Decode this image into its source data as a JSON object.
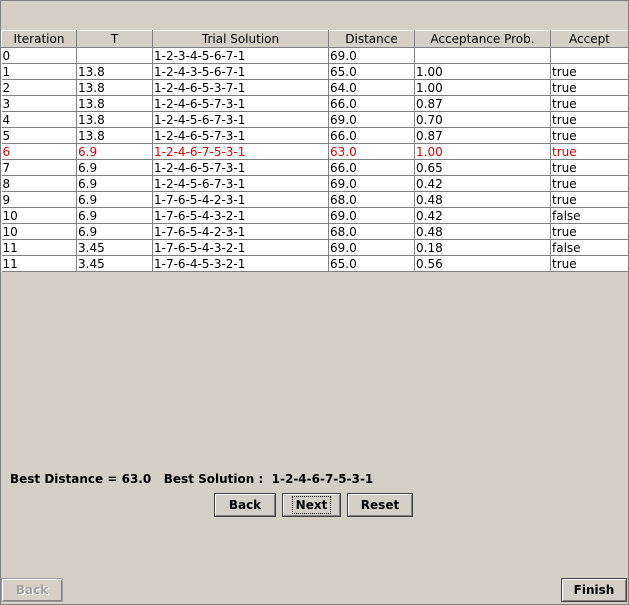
{
  "table": {
    "columns": [
      "Iteration",
      "T",
      "Trial Solution",
      "Distance",
      "Acceptance Prob.",
      "Accept"
    ],
    "rows": [
      [
        "0",
        "",
        "1-2-3-4-5-6-7-1",
        "69.0",
        "",
        ""
      ],
      [
        "1",
        "13.8",
        "1-2-4-3-5-6-7-1",
        "65.0",
        "1.00",
        "true"
      ],
      [
        "2",
        "13.8",
        "1-2-4-6-5-3-7-1",
        "64.0",
        "1.00",
        "true"
      ],
      [
        "3",
        "13.8",
        "1-2-4-6-5-7-3-1",
        "66.0",
        "0.87",
        "true"
      ],
      [
        "4",
        "13.8",
        "1-2-4-5-6-7-3-1",
        "69.0",
        "0.70",
        "true"
      ],
      [
        "5",
        "13.8",
        "1-2-4-6-5-7-3-1",
        "66.0",
        "0.87",
        "true"
      ],
      [
        "6",
        "6.9",
        "1-2-4-6-7-5-3-1",
        "63.0",
        "1.00",
        "true"
      ],
      [
        "7",
        "6.9",
        "1-2-4-6-5-7-3-1",
        "66.0",
        "0.65",
        "true"
      ],
      [
        "8",
        "6.9",
        "1-2-4-5-6-7-3-1",
        "69.0",
        "0.42",
        "true"
      ],
      [
        "9",
        "6.9",
        "1-7-6-5-4-2-3-1",
        "68.0",
        "0.48",
        "true"
      ],
      [
        "10",
        "6.9",
        "1-7-6-5-4-3-2-1",
        "69.0",
        "0.42",
        "false"
      ],
      [
        "10",
        "6.9",
        "1-7-6-5-4-2-3-1",
        "68.0",
        "0.48",
        "true"
      ],
      [
        "11",
        "3.45",
        "1-7-6-5-4-3-2-1",
        "69.0",
        "0.18",
        "false"
      ],
      [
        "11",
        "3.45",
        "1-7-6-4-5-3-2-1",
        "65.0",
        "0.56",
        "true"
      ]
    ],
    "highlight_row_index": 6,
    "highlight_color": "#e00000"
  },
  "summary": {
    "best_distance_label": "Best Distance = 63.0",
    "best_solution_label": "Best Solution :",
    "best_solution_value": "1-2-4-6-7-5-3-1"
  },
  "controls": {
    "back_label": "Back",
    "next_label": "Next",
    "reset_label": "Reset"
  },
  "footer": {
    "back_label": "Back",
    "finish_label": "Finish"
  }
}
